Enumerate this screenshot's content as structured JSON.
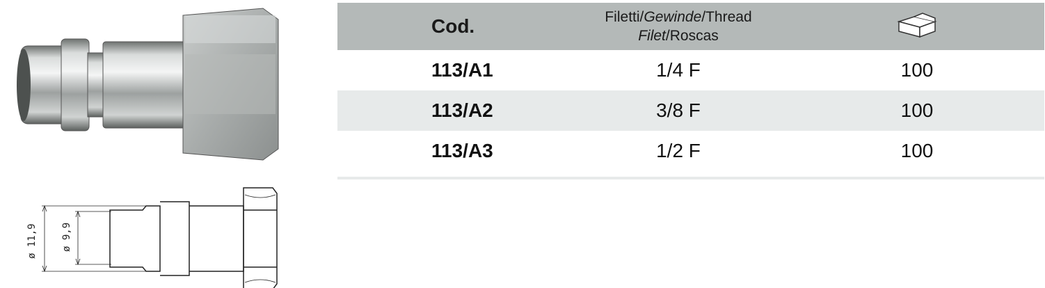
{
  "table": {
    "header": {
      "code": "Cod.",
      "thread_line1": [
        "Filetti/",
        "Gewinde",
        "/Thread"
      ],
      "thread_line2": [
        "Filet",
        "/Roscas"
      ],
      "pack_icon": "box-icon"
    },
    "rows": [
      {
        "code": "113/A1",
        "thread": "1/4 F",
        "qty": "100"
      },
      {
        "code": "113/A2",
        "thread": "3/8 F",
        "qty": "100"
      },
      {
        "code": "113/A3",
        "thread": "1/2 F",
        "qty": "100"
      }
    ]
  },
  "drawing": {
    "dim_outer": "ø 11,9",
    "dim_inner": "ø 9,9"
  },
  "colors": {
    "header_bg": "#b4b9b8",
    "alt_row_bg": "#e7eaea"
  }
}
